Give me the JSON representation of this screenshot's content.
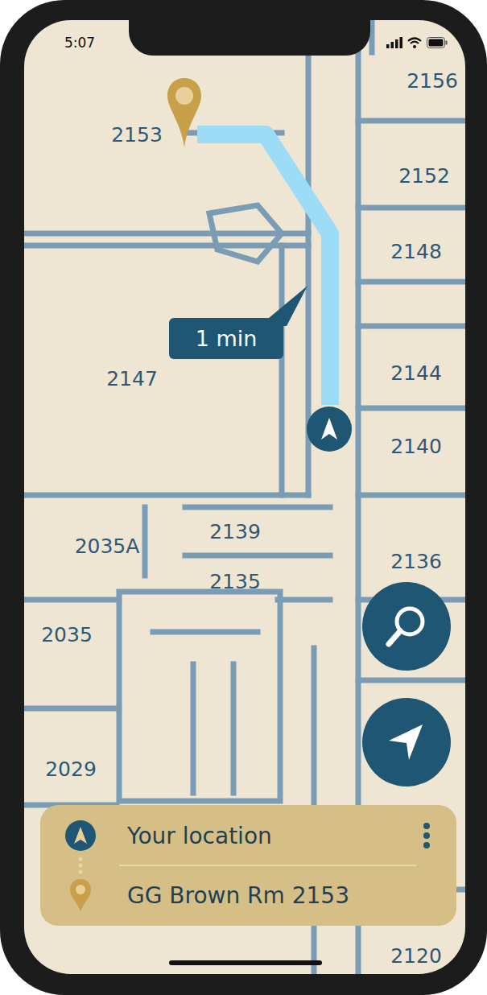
{
  "status_bar": {
    "time": "5:07"
  },
  "map": {
    "rooms": [
      {
        "label": "2156"
      },
      {
        "label": "2153"
      },
      {
        "label": "2152"
      },
      {
        "label": "2148"
      },
      {
        "label": "2144"
      },
      {
        "label": "2147"
      },
      {
        "label": "2140"
      },
      {
        "label": "2139"
      },
      {
        "label": "2035A"
      },
      {
        "label": "2135"
      },
      {
        "label": "2136"
      },
      {
        "label": "2035"
      },
      {
        "label": "2029"
      },
      {
        "label": "2120"
      }
    ],
    "route": {
      "eta": "1 min"
    }
  },
  "directions": {
    "origin": "Your location",
    "destination": "GG Brown Rm 2153"
  }
}
